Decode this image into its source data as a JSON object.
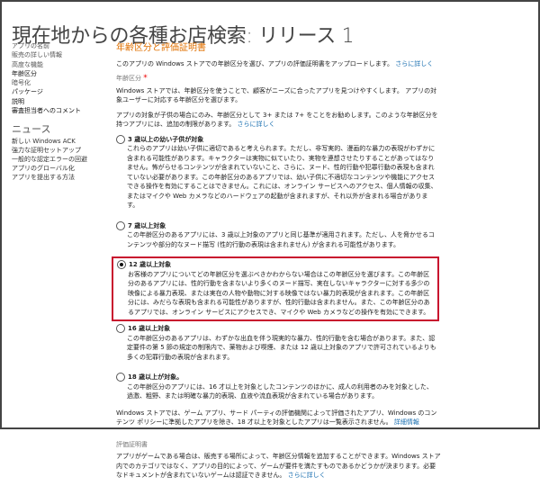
{
  "title": "現在地からの各種お店検索: リリース 1",
  "nav": [
    "アプリの名前",
    "販売の詳しい情報",
    "高度な機能",
    "年齢区分",
    "暗号化",
    "パッケージ",
    "説明",
    "審査担当者へのコメント"
  ],
  "news": {
    "heading": "ニュース",
    "items": [
      "新しい Windows ACK",
      "強力な証明セットアップ",
      "一般的な認定エラーの回避",
      "アプリのグローバル化",
      "アプリを提出する方法"
    ]
  },
  "section": {
    "heading": "年齢区分と評価証明書",
    "intro": "このアプリの Windows ストアでの年齢区分を選び、アプリの評価証明書をアップロードします。",
    "learn_more": "さらに詳しく",
    "age_label": "年齢区分",
    "required": "*",
    "para1": "Windows ストアでは、年齢区分を使うことで、顧客がニーズに合ったアプリを見つけやすくします。 アプリの対象ユーザーに対応する年齢区分を選びます。",
    "para2": "アプリの対象が子供の場合にのみ、年齢区分として 3+ または 7+ をことをお勧めします。このような年齢区分を持つアプリには、追加の制限があります。",
    "para2_link": "さらに詳しく",
    "options": [
      {
        "label": "3 歳以上の幼い子供が対象",
        "selected": false,
        "desc": "これらのアプリは幼い子供に適切であると考えられます。ただし、非写実的、漫画的な暴力の表現がわずかに含まれる可能性があります。キャラクターは実物に似ていたり、実物を連想させたりすることがあってはなりません。怖がらせるコンテンツが含まれていないこと、さらに、ヌード、性的行動や犯罪行動の表現も含まれていない必要があります。この年齢区分のあるアプリでは、幼い子供に不適切なコンテンツや機能にアクセスできる操作を有効にすることはできません。これには、オンライン サービスへのアクセス、個人情報の収集、またはマイクや Web カメラなどのハードウェアの起動が含まれますが、それ以外が含まれる場合があります。"
      },
      {
        "label": "7 歳以上対象",
        "selected": false,
        "desc": "この年齢区分のあるアプリには、3 歳以上対象のアプリと同じ基準が適用されます。ただし、人を脅かせるコンテンツや部分的なヌード描写 (性的行動の表現は含まれません) が含まれる可能性があります。"
      },
      {
        "label": "12 歳以上対象",
        "selected": true,
        "desc": "お客様のアプリについてどの年齢区分を選ぶべきかわからない場合はこの年齢区分を選びます。この年齢区分のあるアプリには、性的行動を含まないより多くのヌード描写、実在しないキャラクターに対する多少の映像による暴力表現、または実在の人物や動物に対する映像ではない暴力的表現が含まれます。この年齢区分には、みだらな表現も含まれる可能性がありますが、性的行動は含まれません。また、この年齢区分のあるアプリでは、オンライン サービスにアクセスでき、マイクや Web カメラなどの操作を有効にできます。"
      },
      {
        "label": "16 歳以上対象",
        "selected": false,
        "desc": "この年齢区分のあるアプリは、わずかな出血を伴う現実的な暴力、性的行動を含む場合があります。また、認定要件の第 5 節の規定の制限内で、薬物および喫煙、または 12 歳以上対象のアプリで許可されているよりも多くの犯罪行動の表現が含まれます。"
      },
      {
        "label": "18 歳以上が対象。",
        "selected": false,
        "desc": "この年齢区分のアプリには、16 才以上を対象としたコンテンツのほかに、成人の利用者のみを対象とした、過激、粗野、または明確な暴力的表現、血液や流血表現が含まれている場合があります。"
      }
    ],
    "store_note": "Windows ストアでは、ゲーム アプリ、サード パーティの評価機関によって評価されたアプリ、Windows のコンテンツ ポリシーに準拠したアプリを除き、18 才以上を対象としたアプリは一覧表示されません。",
    "store_note_link": "詳細情報",
    "cert_label": "評価証明書",
    "cert_text": "アプリがゲームである場合は、販売する場所によって、年齢区分情報を追加することができます。Windows ストア内でのカテゴリではなく、アプリの目的によって、ゲームが要件を満たすものであるかどうかが決まります。必要なドキュメントが含まれていないゲームは認証できません。",
    "cert_link": "さらに詳しく"
  },
  "colors": {
    "accent": "#e07000",
    "link": "#1a6fb0",
    "selection": "#c8102e"
  }
}
